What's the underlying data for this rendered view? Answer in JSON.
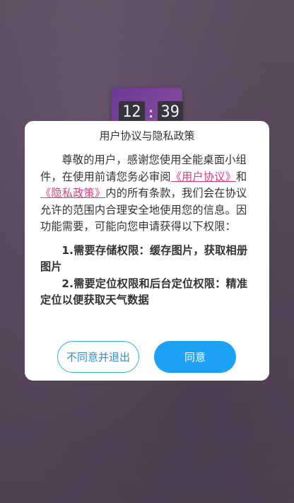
{
  "app_icon": {
    "clock_hour": "12",
    "clock_separator": ":",
    "clock_minute": "39"
  },
  "dialog": {
    "title": "用户协议与隐私政策",
    "intro_1": "尊敬的用户，感谢您使用全能桌面小组件，在使用前请您务必审阅",
    "user_agreement_link": "《用户协议》",
    "and_text": "和",
    "privacy_policy_link": "《隐私政策》",
    "intro_2": "内的所有条款，我们会在协议允许的范围内合理安全地使用您的信息。因功能需要，可能向您申请获得以下权限：",
    "permission_1": "1.需要存储权限：缓存图片，获取相册图片",
    "permission_2": "2.需要定位权限和后台定位权限：精准定位以便获取天气数据",
    "disagree_label": "不同意并退出",
    "agree_label": "同意"
  },
  "colors": {
    "link": "#e03a7f",
    "primary": "#1da1f2"
  }
}
